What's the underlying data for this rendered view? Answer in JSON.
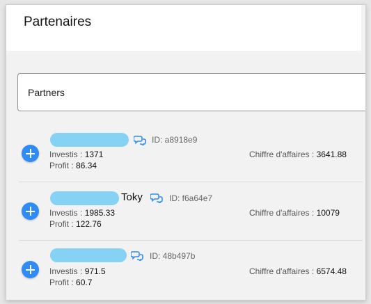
{
  "page": {
    "title": "Partenaires"
  },
  "search": {
    "value": "Partners"
  },
  "labels": {
    "invested": "Investis :",
    "profit": "Profit :",
    "turnover": "Chiffre d'affaires :"
  },
  "partners": [
    {
      "name": "",
      "id_text": "ID: a8918e9",
      "invested": "1371",
      "profit": "86.34",
      "turnover": "3641.88"
    },
    {
      "name": "Toky",
      "id_text": "ID: f6a64e7",
      "invested": "1985.33",
      "profit": "122.76",
      "turnover": "10079"
    },
    {
      "name": "",
      "id_text": "ID: 48b497b",
      "invested": "971.5",
      "profit": "60.7",
      "turnover": "6574.48"
    }
  ],
  "colors": {
    "accent": "#2f8cf6",
    "redaction": "#7fd0f4"
  },
  "icons": {
    "add": "plus-circle",
    "chat": "chat-bubbles"
  }
}
